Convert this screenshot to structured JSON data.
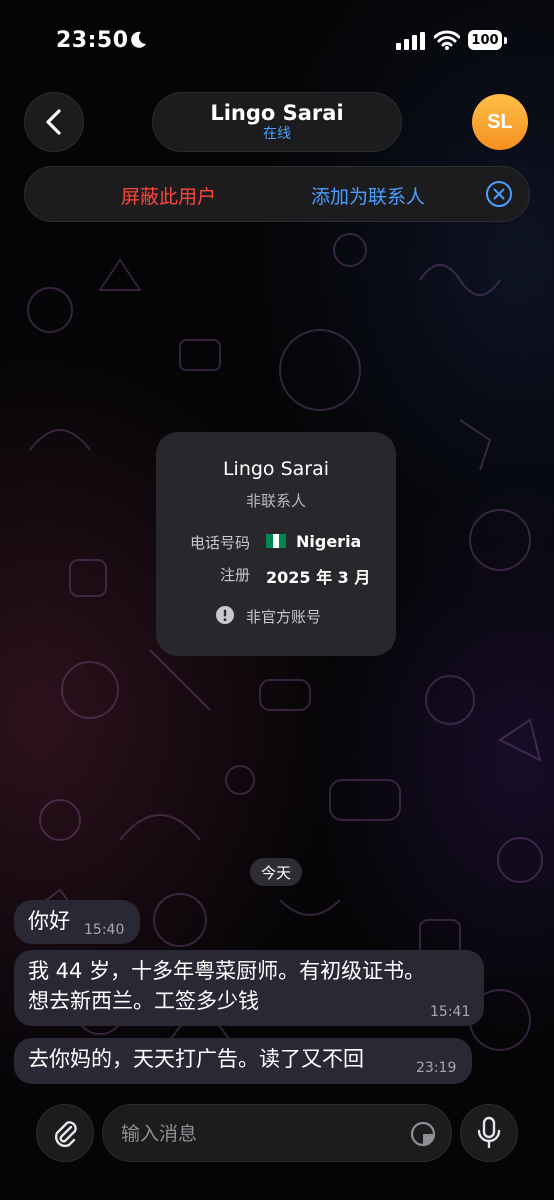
{
  "status_bar": {
    "time": "23:50",
    "battery": "100"
  },
  "header": {
    "contact_name": "Lingo Sarai",
    "status": "在线",
    "avatar_initials": "SL"
  },
  "action_bar": {
    "block_label": "屏蔽此用户",
    "add_contact_label": "添加为联系人"
  },
  "info_card": {
    "name": "Lingo Sarai",
    "subtitle": "非联系人",
    "phone_label": "电话号码",
    "phone_country": "Nigeria",
    "registered_label": "注册",
    "registered_value": "2025 年 3 月",
    "warning": "非官方账号"
  },
  "date_separator": "今天",
  "messages": [
    {
      "lines": [
        "你好"
      ],
      "time": "15:40"
    },
    {
      "lines": [
        "我 44 岁，十多年粤菜厨师。有初级证书。",
        "想去新西兰。工签多少钱"
      ],
      "time": "15:41"
    },
    {
      "lines": [
        "去你妈的，天天打广告。读了又不回"
      ],
      "time": "23:19"
    }
  ],
  "composer": {
    "placeholder": "输入消息"
  },
  "colors": {
    "accent_blue": "#4a9eff",
    "danger_red": "#ff453a",
    "avatar_orange": "#f59020",
    "bubble_incoming": "#2b2836"
  },
  "icons": [
    "moon-icon",
    "signal-icon",
    "wifi-icon",
    "back-chevron-icon",
    "close-circle-icon",
    "nigeria-flag-icon",
    "warning-icon",
    "paperclip-icon",
    "sticker-icon",
    "microphone-icon"
  ]
}
